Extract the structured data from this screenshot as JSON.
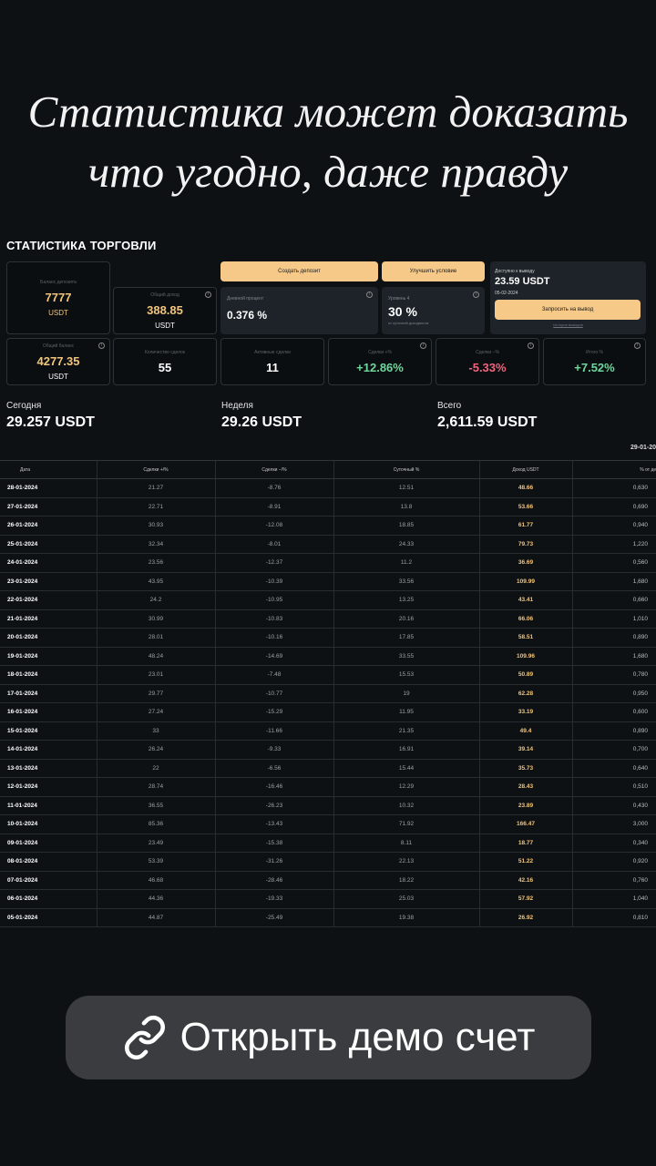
{
  "quote": {
    "line1": "Статистика может доказать",
    "line2": "что угодно, даже правду"
  },
  "stats": {
    "title": "СТАТИСТИКА ТОРГОВЛИ",
    "balance": {
      "label": "Баланс депозита",
      "value": "7777",
      "unit": "USDT"
    },
    "profit": {
      "label": "Общий доход",
      "value": "388.85",
      "unit": "USDT"
    },
    "total_balance": {
      "label": "Общий баланс",
      "value": "4277.35",
      "unit": "USDT"
    },
    "trades": {
      "label": "Количество сделок",
      "value": "55"
    },
    "counter": {
      "label": "Активные сделки",
      "value": "11"
    },
    "daily_pct": {
      "label": "Дневной процент",
      "value": "0.376 %"
    },
    "level": {
      "label": "Уровень 4",
      "value": "30 %",
      "sub": "от суточной доходности"
    },
    "plus_pct": {
      "label": "Сделки +%",
      "value": "+12.86%"
    },
    "minus_pct": {
      "label": "Сделки −%",
      "value": "-5.33%"
    },
    "total_pct": {
      "label": "Итого %",
      "value": "+7.52%"
    },
    "btn_deposit": "Создать депозит",
    "btn_upgrade": "Улучшить условие",
    "withdraw": {
      "label": "Доступно к выводу",
      "value": "23.59 USDT",
      "date": "05-02-2024",
      "button": "Запросить на вывод",
      "link": "История выводов"
    },
    "colors": {
      "accent": "#f6c988",
      "positive": "#6fd79e",
      "negative": "#f0647d"
    }
  },
  "summary": [
    {
      "label": "Сегодня",
      "value": "29.257 USDT"
    },
    {
      "label": "Неделя",
      "value": "29.26 USDT"
    },
    {
      "label": "Всего",
      "value": "2,611.59 USDT"
    }
  ],
  "table_date": "29-01-20",
  "table": {
    "headers": [
      "Дата",
      "Сделки +/%",
      "Сделки −/%",
      "Суточный %",
      "Доход USDT",
      "% от депозит"
    ],
    "rows": [
      [
        "28-01-2024",
        "21.27",
        "-8.76",
        "12.51",
        "48.66",
        "0,630"
      ],
      [
        "27-01-2024",
        "22.71",
        "-8.91",
        "13.8",
        "53.66",
        "0,690"
      ],
      [
        "26-01-2024",
        "30.93",
        "-12.08",
        "18.85",
        "61.77",
        "0,940"
      ],
      [
        "25-01-2024",
        "32.34",
        "-8.01",
        "24.33",
        "79.73",
        "1,220"
      ],
      [
        "24-01-2024",
        "23.56",
        "-12.37",
        "11.2",
        "36.69",
        "0,560"
      ],
      [
        "23-01-2024",
        "43.95",
        "-10.39",
        "33.56",
        "109.99",
        "1,680"
      ],
      [
        "22-01-2024",
        "24.2",
        "-10.95",
        "13.25",
        "43.41",
        "0,660"
      ],
      [
        "21-01-2024",
        "30.99",
        "-10.83",
        "20.16",
        "66.06",
        "1,010"
      ],
      [
        "20-01-2024",
        "28.01",
        "-10.16",
        "17.85",
        "58.51",
        "0,890"
      ],
      [
        "19-01-2024",
        "48.24",
        "-14.69",
        "33.55",
        "109.96",
        "1,680"
      ],
      [
        "18-01-2024",
        "23.01",
        "-7.48",
        "15.53",
        "50.89",
        "0,780"
      ],
      [
        "17-01-2024",
        "29.77",
        "-10.77",
        "19",
        "62.28",
        "0,950"
      ],
      [
        "16-01-2024",
        "27.24",
        "-15.29",
        "11.95",
        "33.19",
        "0,600"
      ],
      [
        "15-01-2024",
        "33",
        "-11.66",
        "21.35",
        "49.4",
        "0,890"
      ],
      [
        "14-01-2024",
        "26.24",
        "-9.33",
        "16.91",
        "39.14",
        "0,700"
      ],
      [
        "13-01-2024",
        "22",
        "-6.56",
        "15.44",
        "35.73",
        "0,640"
      ],
      [
        "12-01-2024",
        "28.74",
        "-16.46",
        "12.29",
        "28.43",
        "0,510"
      ],
      [
        "11-01-2024",
        "36.55",
        "-26.23",
        "10.32",
        "23.89",
        "0,430"
      ],
      [
        "10-01-2024",
        "85.36",
        "-13.43",
        "71.92",
        "166.47",
        "3,000"
      ],
      [
        "09-01-2024",
        "23.49",
        "-15.38",
        "8.11",
        "18.77",
        "0,340"
      ],
      [
        "08-01-2024",
        "53.39",
        "-31.26",
        "22.13",
        "51.22",
        "0,920"
      ],
      [
        "07-01-2024",
        "46.68",
        "-28.46",
        "18.22",
        "42.16",
        "0,760"
      ],
      [
        "06-01-2024",
        "44.36",
        "-19.33",
        "25.03",
        "57.92",
        "1,040"
      ],
      [
        "05-01-2024",
        "44.87",
        "-25.49",
        "19.38",
        "26.92",
        "0,810"
      ]
    ]
  },
  "demo_button": {
    "label": "Открыть демо счет",
    "icon": "link-icon"
  }
}
